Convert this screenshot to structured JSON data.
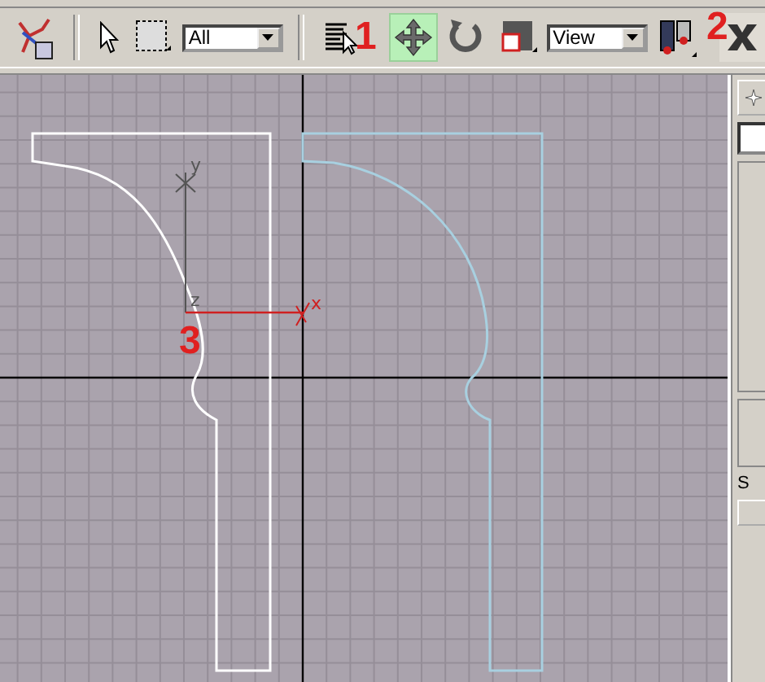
{
  "toolbar": {
    "selection_filter": "All",
    "reference_coord": "View",
    "tools": [
      {
        "kind": "select",
        "selected": false
      },
      {
        "kind": "region",
        "selected": false
      },
      {
        "kind": "filter"
      },
      {
        "kind": "select-by-name",
        "selected": false
      },
      {
        "kind": "move",
        "selected": true
      },
      {
        "kind": "rotate",
        "selected": false
      },
      {
        "kind": "scale",
        "selected": false
      },
      {
        "kind": "coord"
      },
      {
        "kind": "pivot",
        "selected": false
      },
      {
        "kind": "mirror",
        "selected": false
      }
    ]
  },
  "viewport": {
    "axis_labels": [
      "y",
      "z",
      "x"
    ]
  },
  "annotations": [
    "1",
    "2",
    "3"
  ],
  "command_panel": {
    "label": "S"
  }
}
